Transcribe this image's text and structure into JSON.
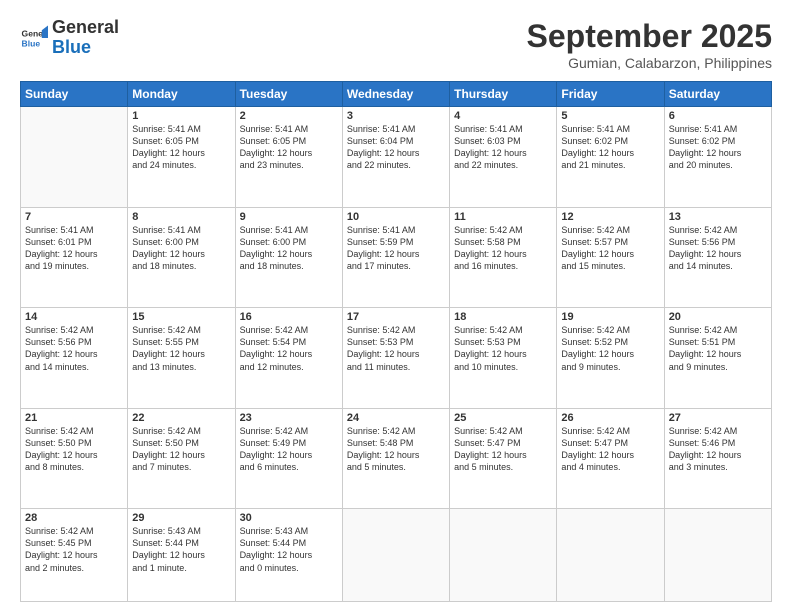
{
  "header": {
    "logo_line1": "General",
    "logo_line2": "Blue",
    "month": "September 2025",
    "location": "Gumian, Calabarzon, Philippines"
  },
  "weekdays": [
    "Sunday",
    "Monday",
    "Tuesday",
    "Wednesday",
    "Thursday",
    "Friday",
    "Saturday"
  ],
  "weeks": [
    [
      {
        "day": "",
        "info": ""
      },
      {
        "day": "1",
        "info": "Sunrise: 5:41 AM\nSunset: 6:05 PM\nDaylight: 12 hours\nand 24 minutes."
      },
      {
        "day": "2",
        "info": "Sunrise: 5:41 AM\nSunset: 6:05 PM\nDaylight: 12 hours\nand 23 minutes."
      },
      {
        "day": "3",
        "info": "Sunrise: 5:41 AM\nSunset: 6:04 PM\nDaylight: 12 hours\nand 22 minutes."
      },
      {
        "day": "4",
        "info": "Sunrise: 5:41 AM\nSunset: 6:03 PM\nDaylight: 12 hours\nand 22 minutes."
      },
      {
        "day": "5",
        "info": "Sunrise: 5:41 AM\nSunset: 6:02 PM\nDaylight: 12 hours\nand 21 minutes."
      },
      {
        "day": "6",
        "info": "Sunrise: 5:41 AM\nSunset: 6:02 PM\nDaylight: 12 hours\nand 20 minutes."
      }
    ],
    [
      {
        "day": "7",
        "info": "Sunrise: 5:41 AM\nSunset: 6:01 PM\nDaylight: 12 hours\nand 19 minutes."
      },
      {
        "day": "8",
        "info": "Sunrise: 5:41 AM\nSunset: 6:00 PM\nDaylight: 12 hours\nand 18 minutes."
      },
      {
        "day": "9",
        "info": "Sunrise: 5:41 AM\nSunset: 6:00 PM\nDaylight: 12 hours\nand 18 minutes."
      },
      {
        "day": "10",
        "info": "Sunrise: 5:41 AM\nSunset: 5:59 PM\nDaylight: 12 hours\nand 17 minutes."
      },
      {
        "day": "11",
        "info": "Sunrise: 5:42 AM\nSunset: 5:58 PM\nDaylight: 12 hours\nand 16 minutes."
      },
      {
        "day": "12",
        "info": "Sunrise: 5:42 AM\nSunset: 5:57 PM\nDaylight: 12 hours\nand 15 minutes."
      },
      {
        "day": "13",
        "info": "Sunrise: 5:42 AM\nSunset: 5:56 PM\nDaylight: 12 hours\nand 14 minutes."
      }
    ],
    [
      {
        "day": "14",
        "info": "Sunrise: 5:42 AM\nSunset: 5:56 PM\nDaylight: 12 hours\nand 14 minutes."
      },
      {
        "day": "15",
        "info": "Sunrise: 5:42 AM\nSunset: 5:55 PM\nDaylight: 12 hours\nand 13 minutes."
      },
      {
        "day": "16",
        "info": "Sunrise: 5:42 AM\nSunset: 5:54 PM\nDaylight: 12 hours\nand 12 minutes."
      },
      {
        "day": "17",
        "info": "Sunrise: 5:42 AM\nSunset: 5:53 PM\nDaylight: 12 hours\nand 11 minutes."
      },
      {
        "day": "18",
        "info": "Sunrise: 5:42 AM\nSunset: 5:53 PM\nDaylight: 12 hours\nand 10 minutes."
      },
      {
        "day": "19",
        "info": "Sunrise: 5:42 AM\nSunset: 5:52 PM\nDaylight: 12 hours\nand 9 minutes."
      },
      {
        "day": "20",
        "info": "Sunrise: 5:42 AM\nSunset: 5:51 PM\nDaylight: 12 hours\nand 9 minutes."
      }
    ],
    [
      {
        "day": "21",
        "info": "Sunrise: 5:42 AM\nSunset: 5:50 PM\nDaylight: 12 hours\nand 8 minutes."
      },
      {
        "day": "22",
        "info": "Sunrise: 5:42 AM\nSunset: 5:50 PM\nDaylight: 12 hours\nand 7 minutes."
      },
      {
        "day": "23",
        "info": "Sunrise: 5:42 AM\nSunset: 5:49 PM\nDaylight: 12 hours\nand 6 minutes."
      },
      {
        "day": "24",
        "info": "Sunrise: 5:42 AM\nSunset: 5:48 PM\nDaylight: 12 hours\nand 5 minutes."
      },
      {
        "day": "25",
        "info": "Sunrise: 5:42 AM\nSunset: 5:47 PM\nDaylight: 12 hours\nand 5 minutes."
      },
      {
        "day": "26",
        "info": "Sunrise: 5:42 AM\nSunset: 5:47 PM\nDaylight: 12 hours\nand 4 minutes."
      },
      {
        "day": "27",
        "info": "Sunrise: 5:42 AM\nSunset: 5:46 PM\nDaylight: 12 hours\nand 3 minutes."
      }
    ],
    [
      {
        "day": "28",
        "info": "Sunrise: 5:42 AM\nSunset: 5:45 PM\nDaylight: 12 hours\nand 2 minutes."
      },
      {
        "day": "29",
        "info": "Sunrise: 5:43 AM\nSunset: 5:44 PM\nDaylight: 12 hours\nand 1 minute."
      },
      {
        "day": "30",
        "info": "Sunrise: 5:43 AM\nSunset: 5:44 PM\nDaylight: 12 hours\nand 0 minutes."
      },
      {
        "day": "",
        "info": ""
      },
      {
        "day": "",
        "info": ""
      },
      {
        "day": "",
        "info": ""
      },
      {
        "day": "",
        "info": ""
      }
    ]
  ]
}
